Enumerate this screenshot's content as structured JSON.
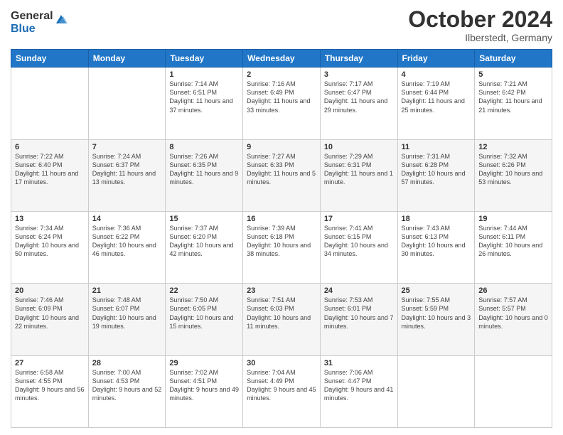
{
  "logo": {
    "general": "General",
    "blue": "Blue"
  },
  "header": {
    "month": "October 2024",
    "location": "Ilberstedt, Germany"
  },
  "days_of_week": [
    "Sunday",
    "Monday",
    "Tuesday",
    "Wednesday",
    "Thursday",
    "Friday",
    "Saturday"
  ],
  "weeks": [
    [
      {
        "day": "",
        "sunrise": "",
        "sunset": "",
        "daylight": ""
      },
      {
        "day": "",
        "sunrise": "",
        "sunset": "",
        "daylight": ""
      },
      {
        "day": "1",
        "sunrise": "Sunrise: 7:14 AM",
        "sunset": "Sunset: 6:51 PM",
        "daylight": "Daylight: 11 hours and 37 minutes."
      },
      {
        "day": "2",
        "sunrise": "Sunrise: 7:16 AM",
        "sunset": "Sunset: 6:49 PM",
        "daylight": "Daylight: 11 hours and 33 minutes."
      },
      {
        "day": "3",
        "sunrise": "Sunrise: 7:17 AM",
        "sunset": "Sunset: 6:47 PM",
        "daylight": "Daylight: 11 hours and 29 minutes."
      },
      {
        "day": "4",
        "sunrise": "Sunrise: 7:19 AM",
        "sunset": "Sunset: 6:44 PM",
        "daylight": "Daylight: 11 hours and 25 minutes."
      },
      {
        "day": "5",
        "sunrise": "Sunrise: 7:21 AM",
        "sunset": "Sunset: 6:42 PM",
        "daylight": "Daylight: 11 hours and 21 minutes."
      }
    ],
    [
      {
        "day": "6",
        "sunrise": "Sunrise: 7:22 AM",
        "sunset": "Sunset: 6:40 PM",
        "daylight": "Daylight: 11 hours and 17 minutes."
      },
      {
        "day": "7",
        "sunrise": "Sunrise: 7:24 AM",
        "sunset": "Sunset: 6:37 PM",
        "daylight": "Daylight: 11 hours and 13 minutes."
      },
      {
        "day": "8",
        "sunrise": "Sunrise: 7:26 AM",
        "sunset": "Sunset: 6:35 PM",
        "daylight": "Daylight: 11 hours and 9 minutes."
      },
      {
        "day": "9",
        "sunrise": "Sunrise: 7:27 AM",
        "sunset": "Sunset: 6:33 PM",
        "daylight": "Daylight: 11 hours and 5 minutes."
      },
      {
        "day": "10",
        "sunrise": "Sunrise: 7:29 AM",
        "sunset": "Sunset: 6:31 PM",
        "daylight": "Daylight: 11 hours and 1 minute."
      },
      {
        "day": "11",
        "sunrise": "Sunrise: 7:31 AM",
        "sunset": "Sunset: 6:28 PM",
        "daylight": "Daylight: 10 hours and 57 minutes."
      },
      {
        "day": "12",
        "sunrise": "Sunrise: 7:32 AM",
        "sunset": "Sunset: 6:26 PM",
        "daylight": "Daylight: 10 hours and 53 minutes."
      }
    ],
    [
      {
        "day": "13",
        "sunrise": "Sunrise: 7:34 AM",
        "sunset": "Sunset: 6:24 PM",
        "daylight": "Daylight: 10 hours and 50 minutes."
      },
      {
        "day": "14",
        "sunrise": "Sunrise: 7:36 AM",
        "sunset": "Sunset: 6:22 PM",
        "daylight": "Daylight: 10 hours and 46 minutes."
      },
      {
        "day": "15",
        "sunrise": "Sunrise: 7:37 AM",
        "sunset": "Sunset: 6:20 PM",
        "daylight": "Daylight: 10 hours and 42 minutes."
      },
      {
        "day": "16",
        "sunrise": "Sunrise: 7:39 AM",
        "sunset": "Sunset: 6:18 PM",
        "daylight": "Daylight: 10 hours and 38 minutes."
      },
      {
        "day": "17",
        "sunrise": "Sunrise: 7:41 AM",
        "sunset": "Sunset: 6:15 PM",
        "daylight": "Daylight: 10 hours and 34 minutes."
      },
      {
        "day": "18",
        "sunrise": "Sunrise: 7:43 AM",
        "sunset": "Sunset: 6:13 PM",
        "daylight": "Daylight: 10 hours and 30 minutes."
      },
      {
        "day": "19",
        "sunrise": "Sunrise: 7:44 AM",
        "sunset": "Sunset: 6:11 PM",
        "daylight": "Daylight: 10 hours and 26 minutes."
      }
    ],
    [
      {
        "day": "20",
        "sunrise": "Sunrise: 7:46 AM",
        "sunset": "Sunset: 6:09 PM",
        "daylight": "Daylight: 10 hours and 22 minutes."
      },
      {
        "day": "21",
        "sunrise": "Sunrise: 7:48 AM",
        "sunset": "Sunset: 6:07 PM",
        "daylight": "Daylight: 10 hours and 19 minutes."
      },
      {
        "day": "22",
        "sunrise": "Sunrise: 7:50 AM",
        "sunset": "Sunset: 6:05 PM",
        "daylight": "Daylight: 10 hours and 15 minutes."
      },
      {
        "day": "23",
        "sunrise": "Sunrise: 7:51 AM",
        "sunset": "Sunset: 6:03 PM",
        "daylight": "Daylight: 10 hours and 11 minutes."
      },
      {
        "day": "24",
        "sunrise": "Sunrise: 7:53 AM",
        "sunset": "Sunset: 6:01 PM",
        "daylight": "Daylight: 10 hours and 7 minutes."
      },
      {
        "day": "25",
        "sunrise": "Sunrise: 7:55 AM",
        "sunset": "Sunset: 5:59 PM",
        "daylight": "Daylight: 10 hours and 3 minutes."
      },
      {
        "day": "26",
        "sunrise": "Sunrise: 7:57 AM",
        "sunset": "Sunset: 5:57 PM",
        "daylight": "Daylight: 10 hours and 0 minutes."
      }
    ],
    [
      {
        "day": "27",
        "sunrise": "Sunrise: 6:58 AM",
        "sunset": "Sunset: 4:55 PM",
        "daylight": "Daylight: 9 hours and 56 minutes."
      },
      {
        "day": "28",
        "sunrise": "Sunrise: 7:00 AM",
        "sunset": "Sunset: 4:53 PM",
        "daylight": "Daylight: 9 hours and 52 minutes."
      },
      {
        "day": "29",
        "sunrise": "Sunrise: 7:02 AM",
        "sunset": "Sunset: 4:51 PM",
        "daylight": "Daylight: 9 hours and 49 minutes."
      },
      {
        "day": "30",
        "sunrise": "Sunrise: 7:04 AM",
        "sunset": "Sunset: 4:49 PM",
        "daylight": "Daylight: 9 hours and 45 minutes."
      },
      {
        "day": "31",
        "sunrise": "Sunrise: 7:06 AM",
        "sunset": "Sunset: 4:47 PM",
        "daylight": "Daylight: 9 hours and 41 minutes."
      },
      {
        "day": "",
        "sunrise": "",
        "sunset": "",
        "daylight": ""
      },
      {
        "day": "",
        "sunrise": "",
        "sunset": "",
        "daylight": ""
      }
    ]
  ]
}
